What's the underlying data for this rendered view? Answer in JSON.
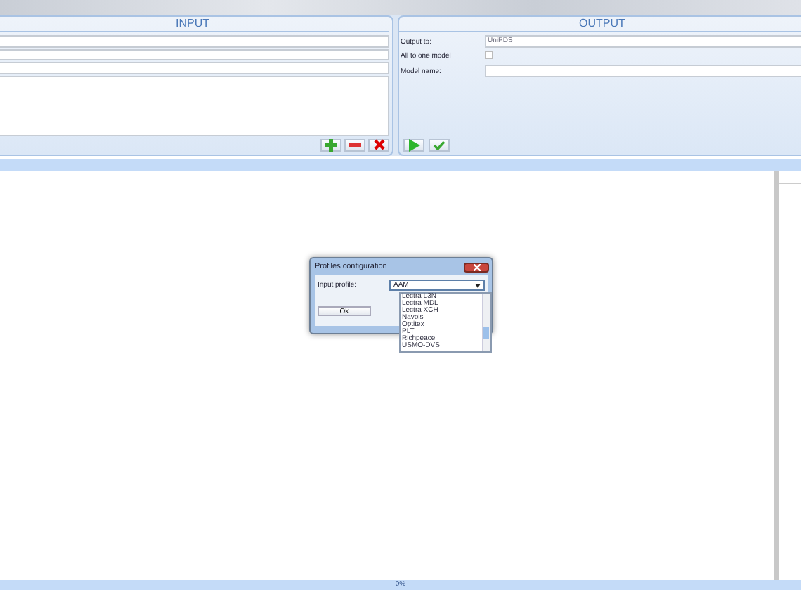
{
  "input": {
    "title": "INPUT"
  },
  "output": {
    "title": "OUTPUT",
    "fields": [
      {
        "kind": "text",
        "label": "Output to:",
        "value": "UniPDS"
      },
      {
        "kind": "checkbox",
        "label": "All to one model",
        "checked": false
      },
      {
        "kind": "text",
        "label": "Model name:"
      }
    ]
  },
  "dialog": {
    "title": "Profiles configuration",
    "label": "Input profile:",
    "value": "AAM",
    "button": "Ok",
    "options": [
      "Lectra L3N",
      "Lectra MDL",
      "Lectra XCH",
      "Navois",
      "Optitex",
      "PLT",
      "Richpeace",
      "USMO-DVS"
    ]
  },
  "status_bar": {
    "progress": "0%"
  }
}
